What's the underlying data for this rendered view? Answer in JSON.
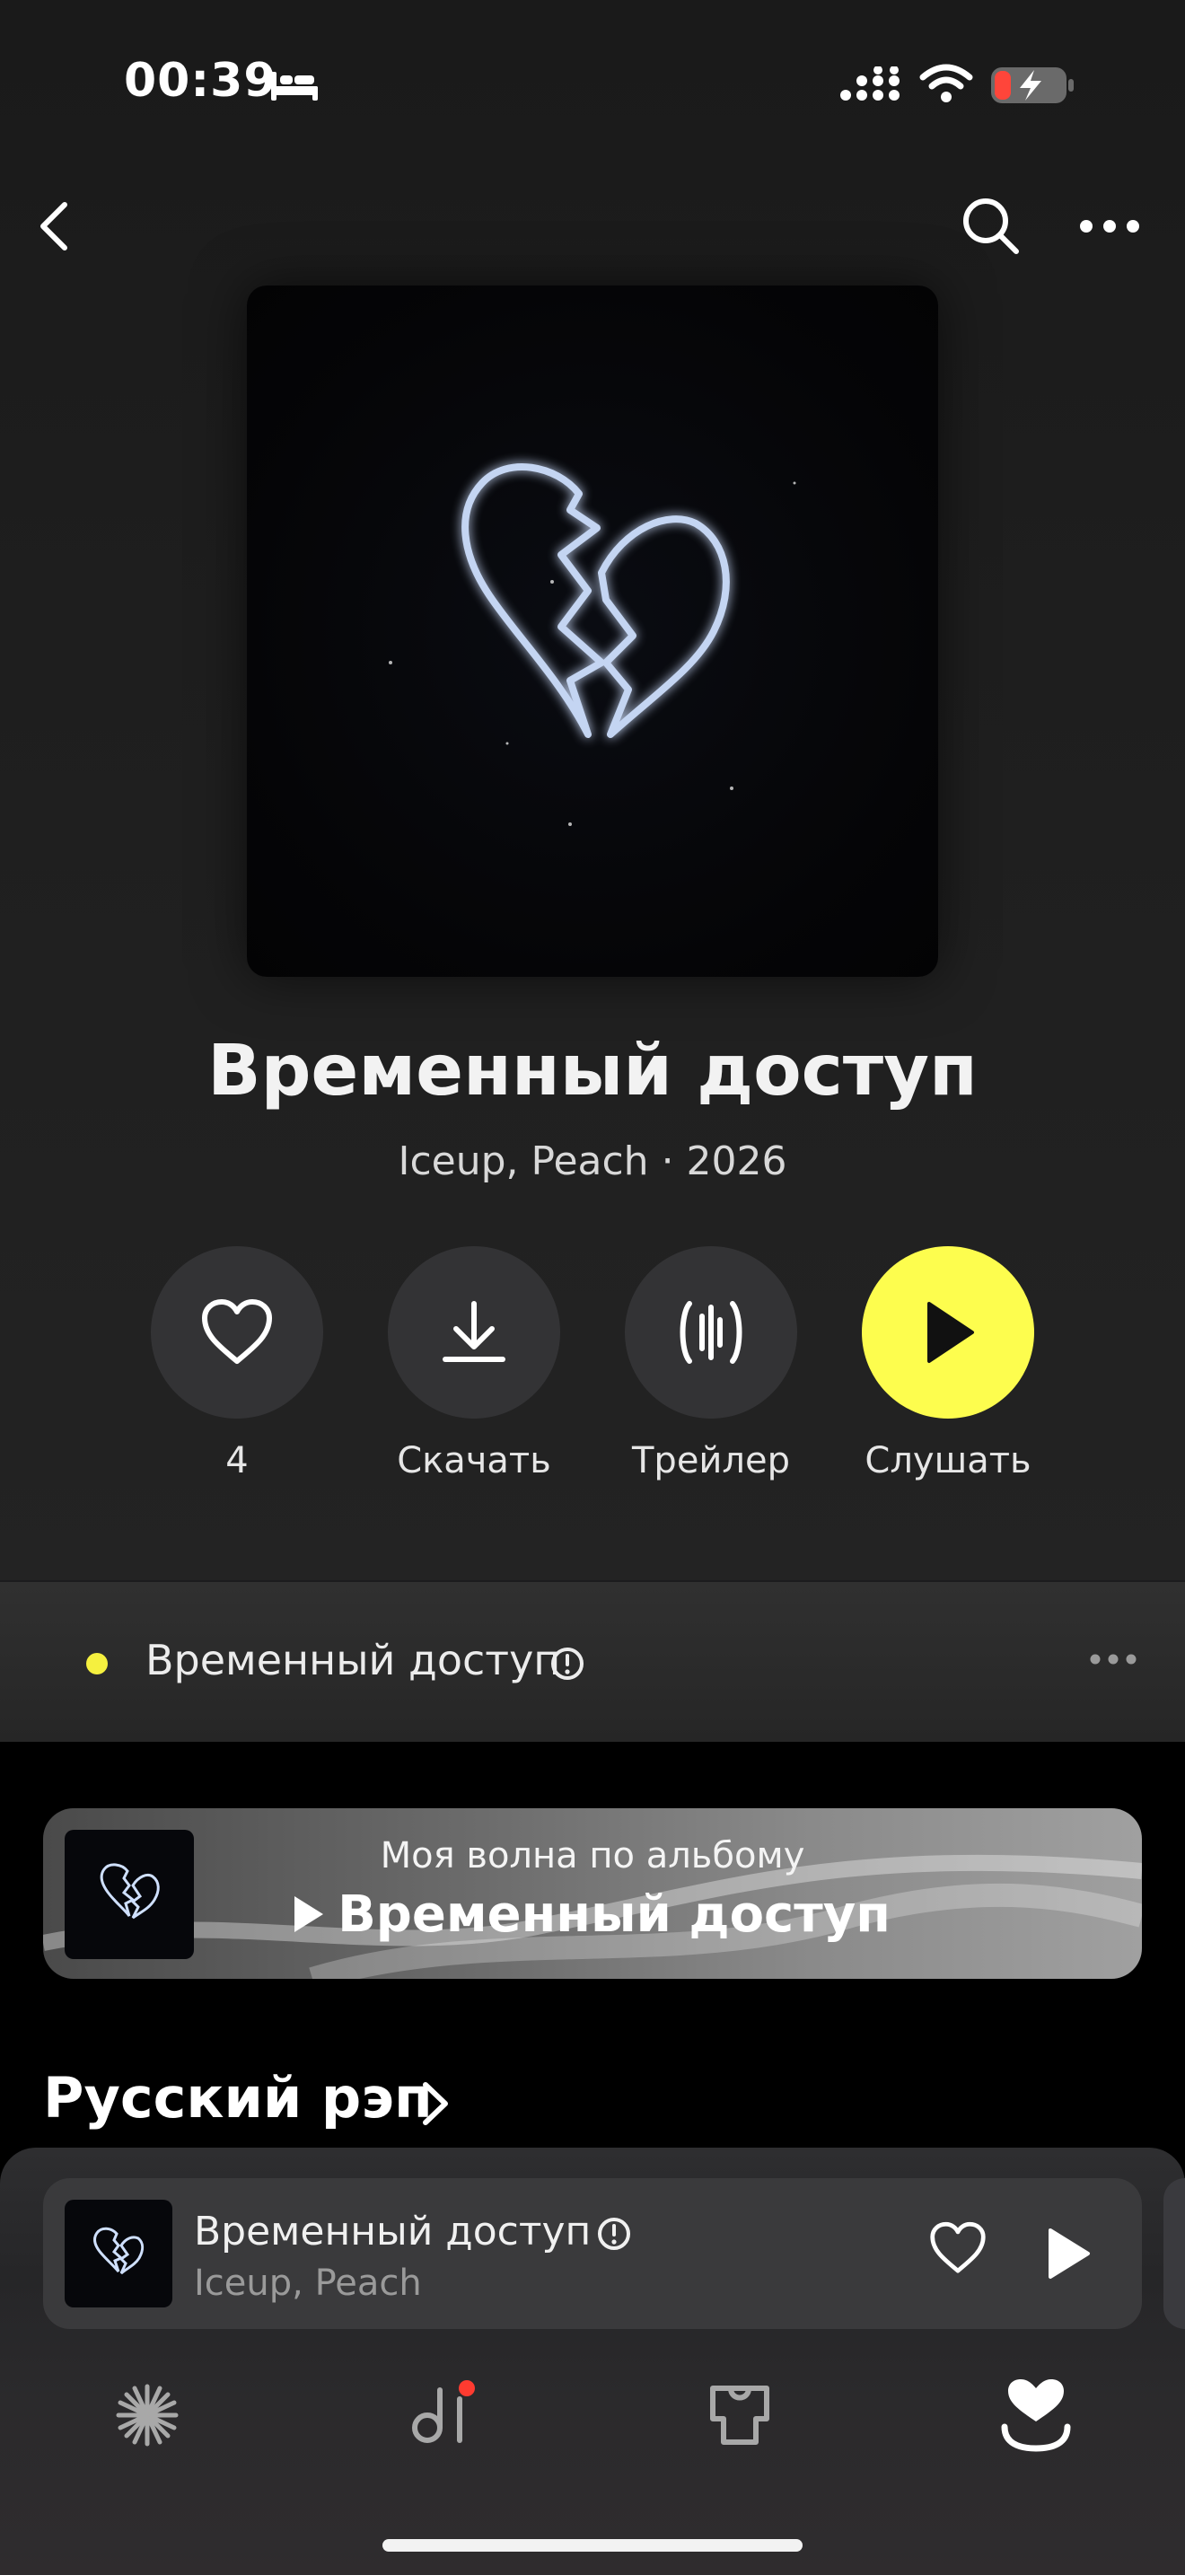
{
  "status_bar": {
    "time": "00:39"
  },
  "album": {
    "title": "Временный доступ",
    "artists": "Iceup, Peach",
    "separator": " · ",
    "year": "2026"
  },
  "actions": {
    "like_count": "4",
    "download_label": "Скачать",
    "trailer_label": "Трейлер",
    "listen_label": "Слушать"
  },
  "track": {
    "title": "Временный доступ"
  },
  "wave": {
    "subtitle": "Моя волна по альбому",
    "title": "Временный доступ"
  },
  "section": {
    "title": "Русский рэп"
  },
  "mini_player": {
    "title": "Временный доступ",
    "artist": "Iceup, Peach"
  },
  "colors": {
    "accent_yellow": "#fdfd4e",
    "playing_dot": "#f5f03f",
    "notification_dot": "#ff3b30"
  },
  "icons": [
    "bed-icon",
    "signal-icon",
    "wifi-icon",
    "battery-charging-icon",
    "back-icon",
    "search-icon",
    "more-icon",
    "heart-icon",
    "download-icon",
    "trailer-icon",
    "play-icon",
    "explicit-icon",
    "chevron-right-icon",
    "wave-icon",
    "collection-icon",
    "podcast-icon",
    "favorites-icon"
  ]
}
